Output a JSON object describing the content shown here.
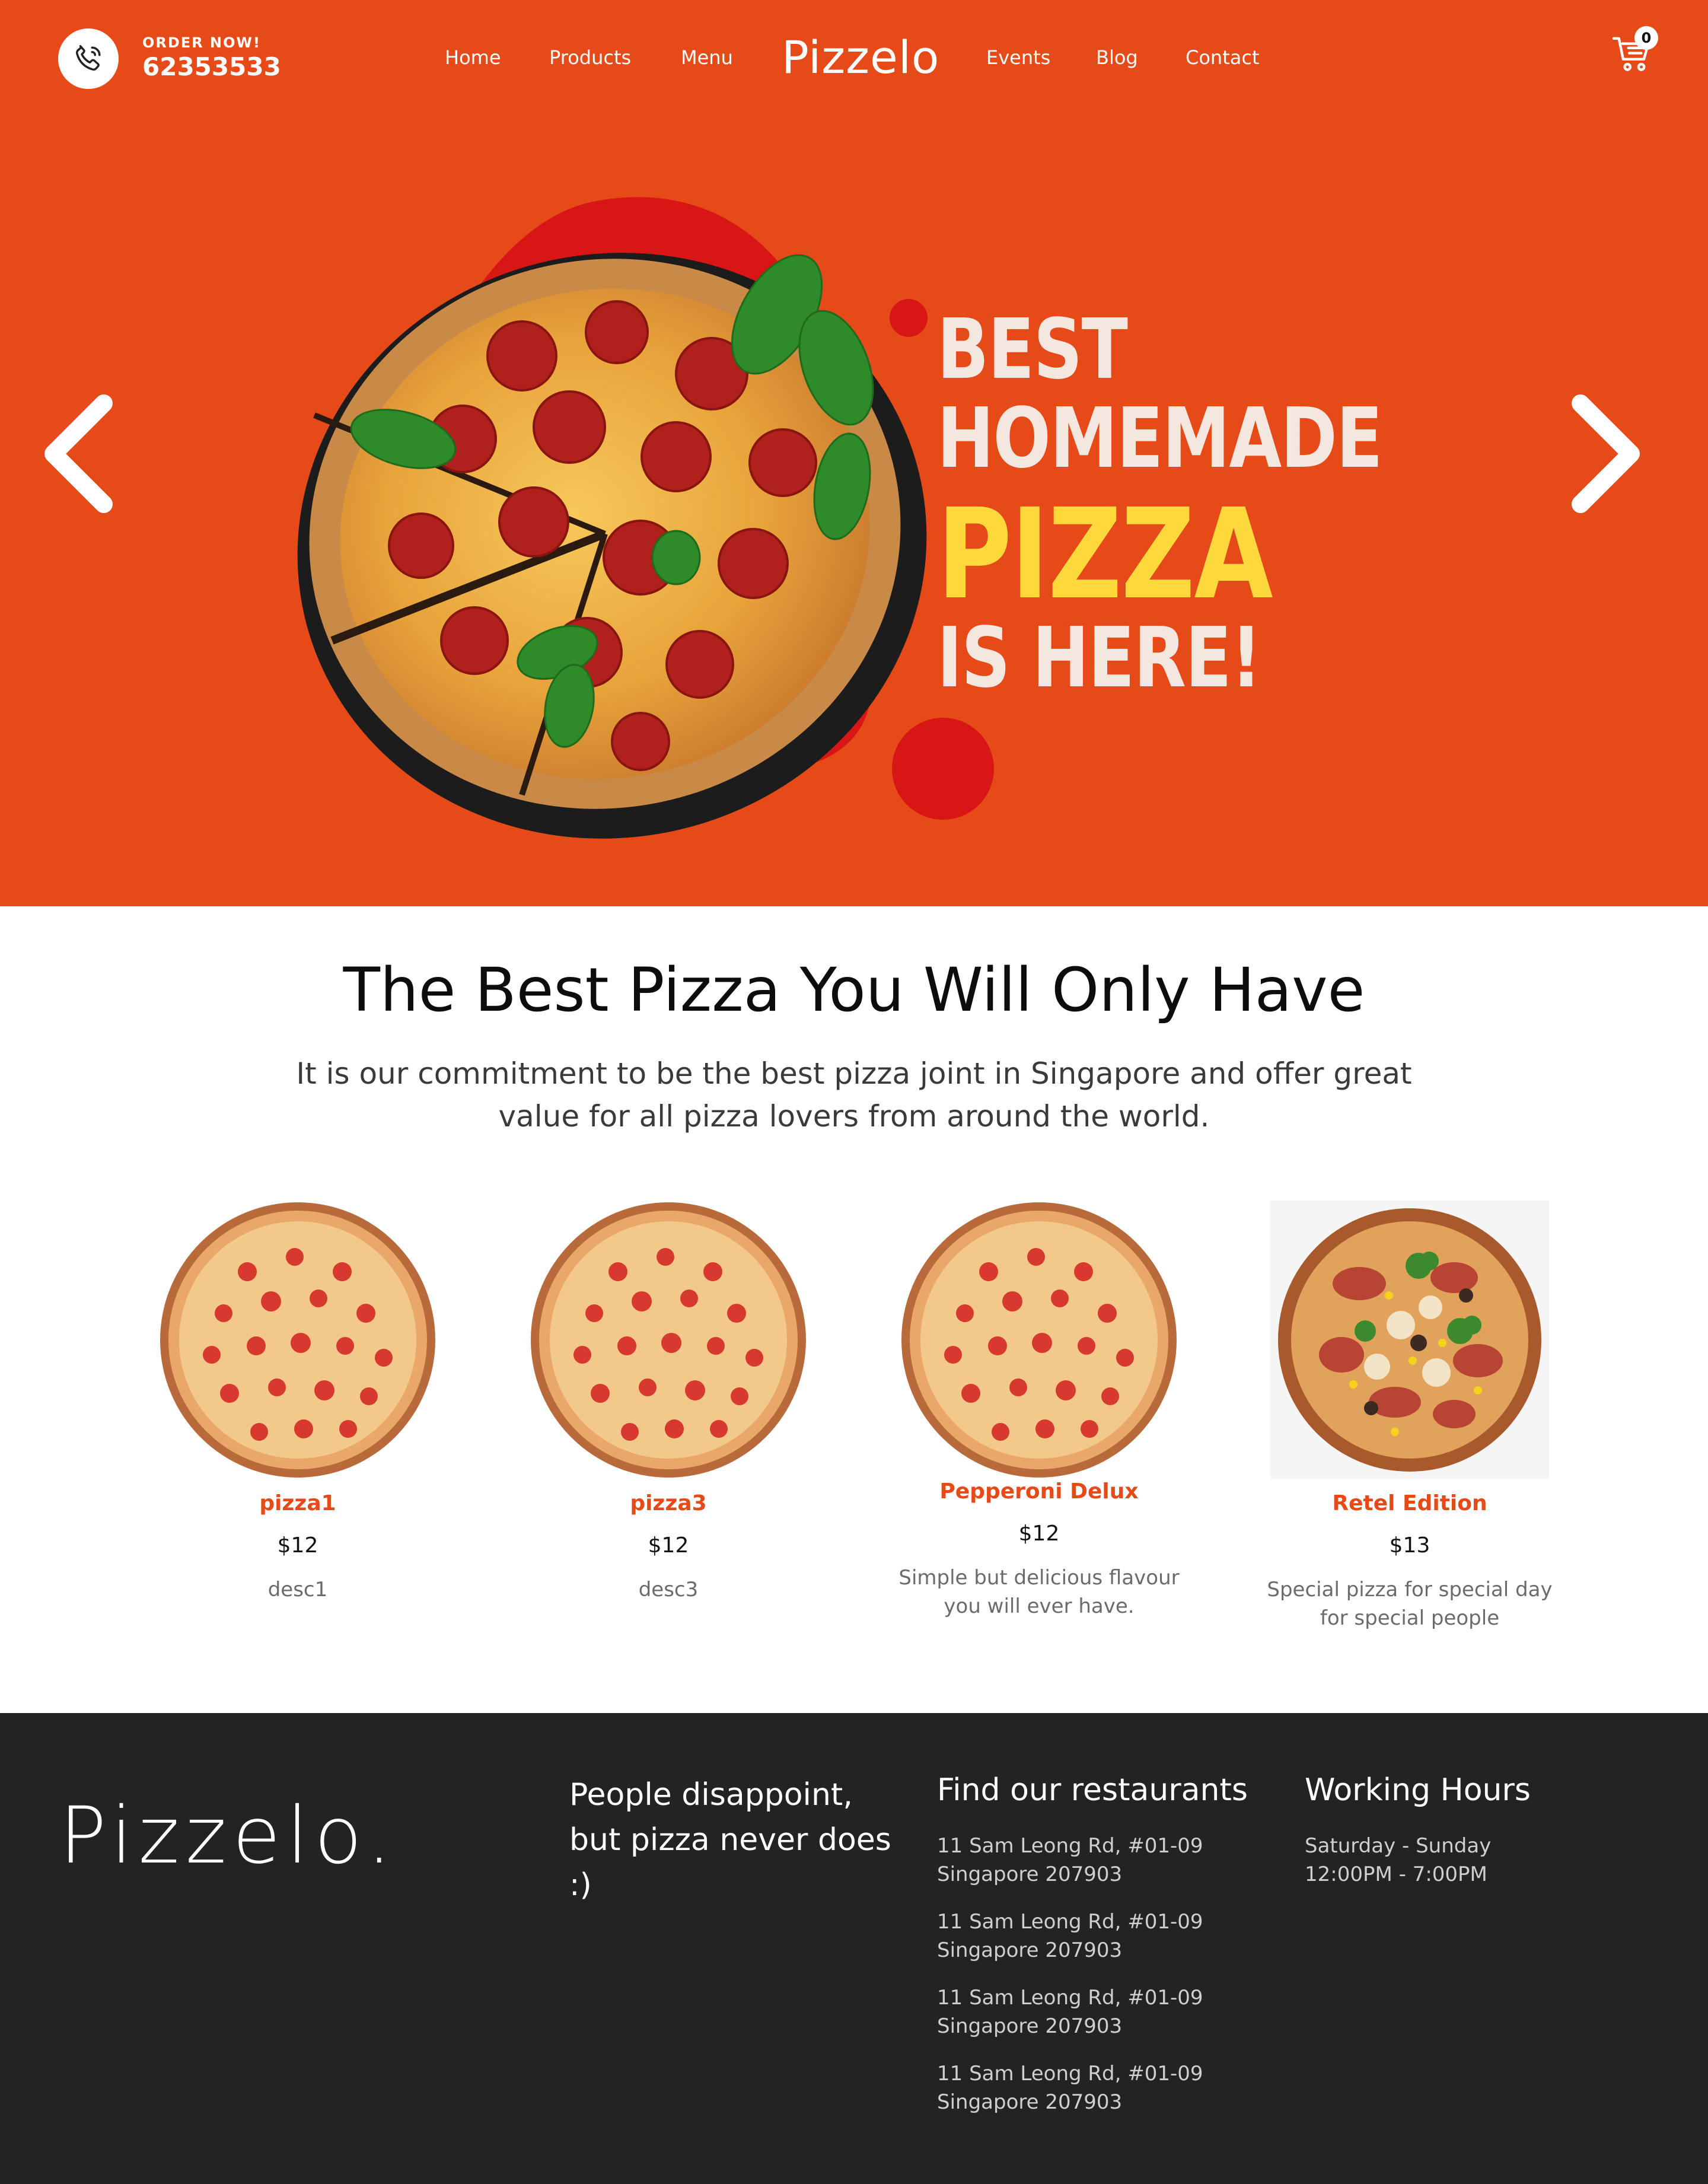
{
  "header": {
    "order_label": "ORDER NOW!",
    "order_number": "62353533",
    "brand": "Pizzelo",
    "nav_left": [
      "Home",
      "Products",
      "Menu"
    ],
    "nav_right": [
      "Events",
      "Blog",
      "Contact"
    ],
    "cart_count": "0"
  },
  "hero": {
    "line1": "BEST",
    "line2": "HOMEMADE",
    "line3": "PIZZA",
    "line4": "IS HERE!"
  },
  "intro": {
    "title": "The Best Pizza You Will Only Have",
    "text": "It is our commitment to be the best pizza joint in Singapore and offer great value for all pizza lovers from around the world."
  },
  "products": [
    {
      "name": "pizza1",
      "price": "$12",
      "desc": "desc1"
    },
    {
      "name": "pizza3",
      "price": "$12",
      "desc": "desc3"
    },
    {
      "name": "Pepperoni Delux",
      "price": "$12",
      "desc": "Simple but delicious flavour you will ever have."
    },
    {
      "name": "Retel Edition",
      "price": "$13",
      "desc": "Special pizza for special day for special people"
    }
  ],
  "footer": {
    "brand": "Pizzelo.",
    "tagline": "People disappoint, but pizza never does :)",
    "restaurants_title": "Find our restaurants",
    "addresses": [
      {
        "line1": "11 Sam Leong Rd, #01-09",
        "line2": "Singapore 207903"
      },
      {
        "line1": "11 Sam Leong Rd, #01-09",
        "line2": "Singapore 207903"
      },
      {
        "line1": "11 Sam Leong Rd, #01-09",
        "line2": "Singapore 207903"
      },
      {
        "line1": "11 Sam Leong Rd, #01-09",
        "line2": "Singapore 207903"
      }
    ],
    "hours_title": "Working Hours",
    "hours_days": "Saturday - Sunday",
    "hours_time": "12:00PM - 7:00PM"
  },
  "colors": {
    "brand_orange": "#e64a19",
    "hero_accent_red": "#d81616",
    "hero_highlight_yellow": "#ffd93b",
    "footer_bg": "#232323"
  },
  "icons": [
    "phone-icon",
    "cart-icon",
    "chevron-left-icon",
    "chevron-right-icon"
  ]
}
